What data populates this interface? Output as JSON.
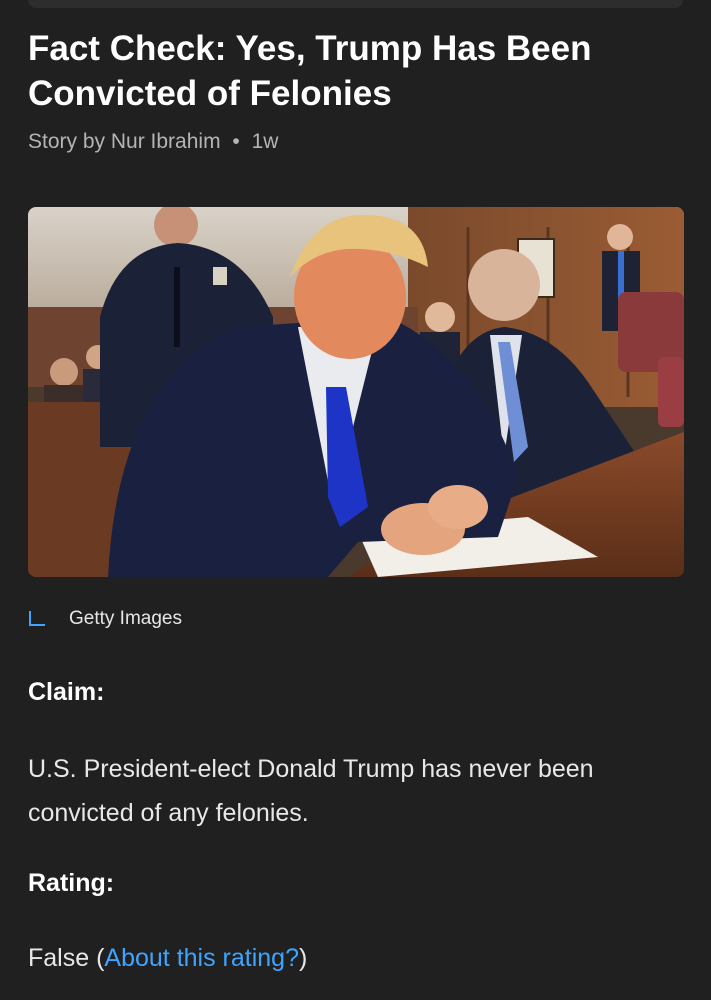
{
  "article": {
    "title": "Fact Check: Yes, Trump Has Been Convicted of Felonies",
    "byline": {
      "author": "Story by Nur Ibrahim",
      "separator": "•",
      "age": "1w"
    },
    "image": {
      "credit": "Getty Images",
      "credit_icon": "corner-bracket-icon"
    },
    "claim": {
      "label": "Claim:",
      "text": "U.S. President-elect Donald Trump has never been convicted of any felonies."
    },
    "rating": {
      "label": "Rating:",
      "value": "False",
      "open_paren": "(",
      "link": "About this rating?",
      "close_paren": ")"
    }
  },
  "colors": {
    "background": "#202020",
    "text": "#ffffff",
    "muted": "#b4b4b4",
    "link": "#3da5ff"
  }
}
